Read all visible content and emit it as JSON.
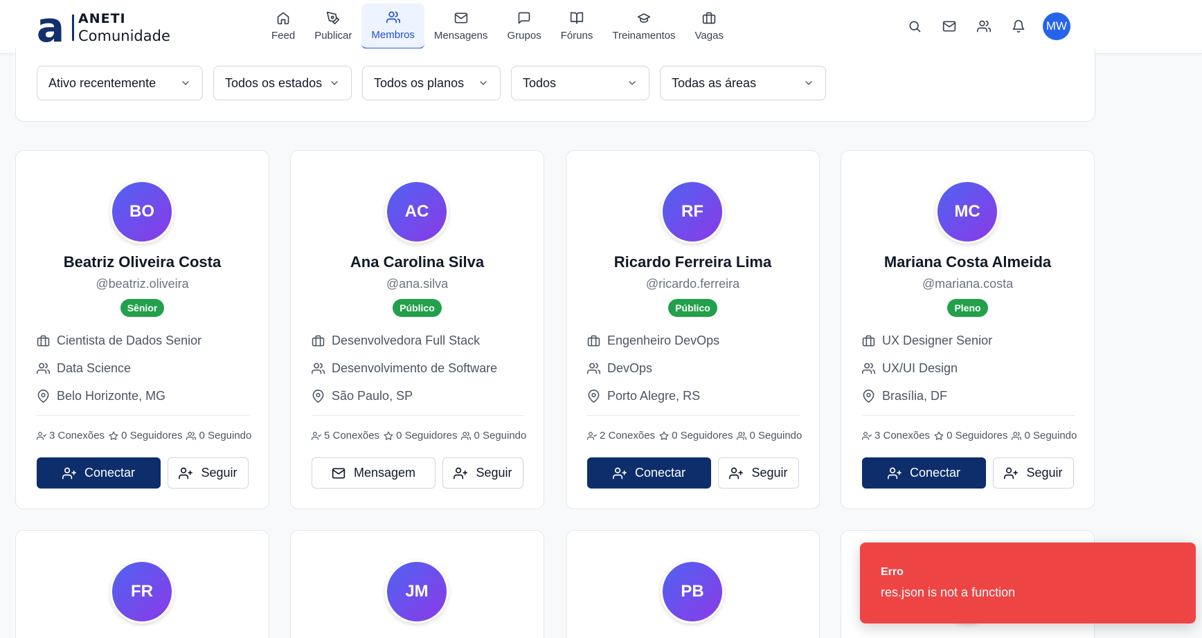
{
  "brand": {
    "mark": "a",
    "top": "ANETI",
    "bottom": "Comunidade"
  },
  "nav": [
    {
      "label": "Feed",
      "icon": "home-icon"
    },
    {
      "label": "Publicar",
      "icon": "pen-icon"
    },
    {
      "label": "Membros",
      "icon": "users-icon",
      "active": true
    },
    {
      "label": "Mensagens",
      "icon": "mail-icon"
    },
    {
      "label": "Grupos",
      "icon": "chat-icon"
    },
    {
      "label": "Fóruns",
      "icon": "book-icon"
    },
    {
      "label": "Treinamentos",
      "icon": "graduation-cap-icon"
    },
    {
      "label": "Vagas",
      "icon": "briefcase-icon"
    }
  ],
  "header": {
    "user_initials": "MW"
  },
  "filters": [
    {
      "value": "Ativo recentemente"
    },
    {
      "value": "Todos os estados"
    },
    {
      "value": "Todos os planos"
    },
    {
      "value": "Todos"
    },
    {
      "value": "Todas as áreas"
    }
  ],
  "members": [
    {
      "initials": "BO",
      "name": "Beatriz Oliveira Costa",
      "handle": "@beatriz.oliveira",
      "badge": "Sênior",
      "role": "Cientista de Dados Senior",
      "area": "Data Science",
      "location": "Belo Horizonte, MG",
      "connections": "3 Conexões",
      "followers": "0 Seguidores",
      "following": "0 Seguindo",
      "primary_action": "Conectar",
      "secondary_action": "Seguir"
    },
    {
      "initials": "AC",
      "name": "Ana Carolina Silva",
      "handle": "@ana.silva",
      "badge": "Público",
      "role": "Desenvolvedora Full Stack",
      "area": "Desenvolvimento de Software",
      "location": "São Paulo, SP",
      "connections": "5 Conexões",
      "followers": "0 Seguidores",
      "following": "0 Seguindo",
      "primary_action": "Mensagem",
      "secondary_action": "Seguir"
    },
    {
      "initials": "RF",
      "name": "Ricardo Ferreira Lima",
      "handle": "@ricardo.ferreira",
      "badge": "Público",
      "role": "Engenheiro DevOps",
      "area": "DevOps",
      "location": "Porto Alegre, RS",
      "connections": "2 Conexões",
      "followers": "0 Seguidores",
      "following": "0 Seguindo",
      "primary_action": "Conectar",
      "secondary_action": "Seguir"
    },
    {
      "initials": "MC",
      "name": "Mariana Costa Almeida",
      "handle": "@mariana.costa",
      "badge": "Pleno",
      "role": "UX Designer Senior",
      "area": "UX/UI Design",
      "location": "Brasília, DF",
      "connections": "3 Conexões",
      "followers": "0 Seguidores",
      "following": "0 Seguindo",
      "primary_action": "Conectar",
      "secondary_action": "Seguir"
    }
  ],
  "members_row2": [
    {
      "initials": "FR"
    },
    {
      "initials": "JM"
    },
    {
      "initials": "PB"
    },
    {
      "initials": ""
    }
  ],
  "toast": {
    "title": "Erro",
    "message": "res.json is not a function"
  },
  "colors": {
    "primary": "#0d2d6b",
    "accent": "#2563eb",
    "badge": "#22a04b",
    "error": "#ef4444"
  }
}
